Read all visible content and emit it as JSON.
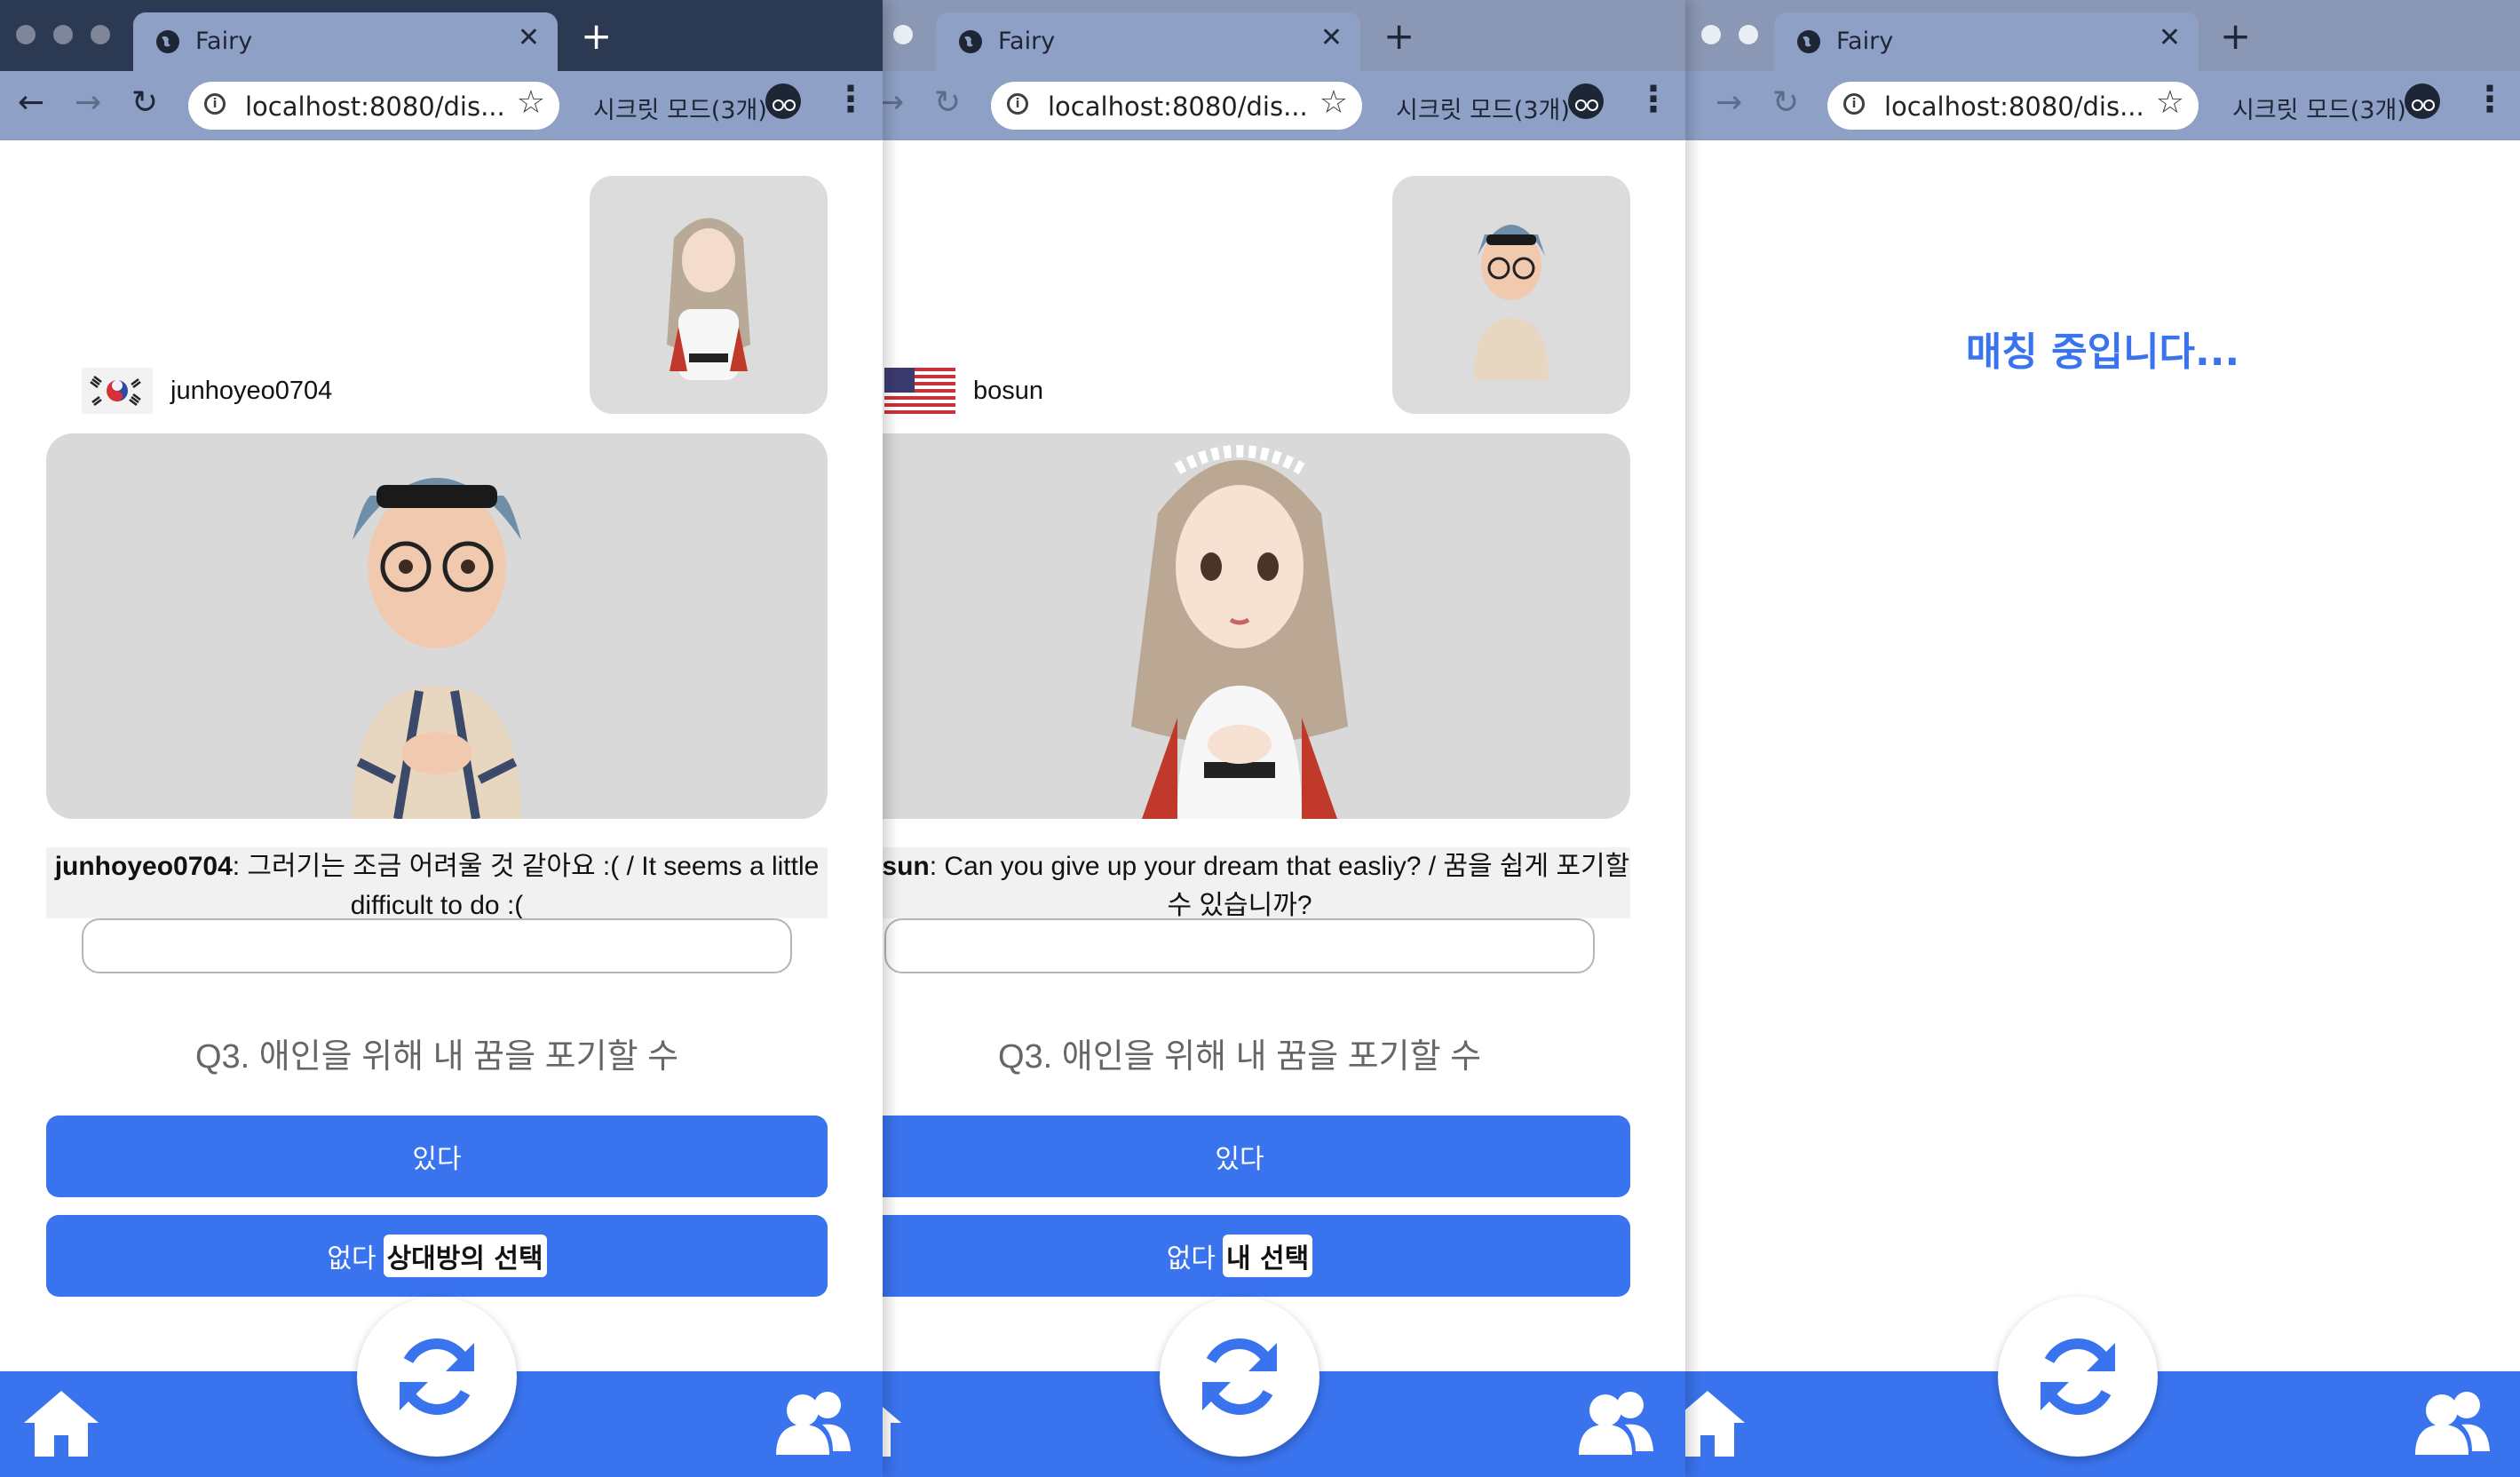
{
  "colors": {
    "accent": "#3a73ee",
    "video_bg": "#d9d9d9",
    "caption_bg": "#f1f1f1"
  },
  "browser": {
    "tab_title": "Fairy",
    "url": "localhost:8080/dis...",
    "incognito_label": "시크릿 모드(3개)"
  },
  "windows": [
    {
      "user": {
        "name": "junhoyeo0704",
        "flag": "south-korea-flag"
      },
      "caption": {
        "speaker": "junhoyeo0704",
        "text": ": 그러기는 조금 어려울 것 같아요 :( / It seems a little difficult to do :("
      },
      "question": "Q3. 애인을 위해 내 꿈을 포기할 수",
      "yes_label": "있다",
      "no_label": "없다",
      "selection_tag": "상대방의 선택"
    },
    {
      "user": {
        "name": "bosun",
        "flag": "usa-flag"
      },
      "caption": {
        "speaker": "bosun",
        "text": ": Can you give up your dream that easliy? / 꿈을 쉽게 포기할 수 있습니까?"
      },
      "question": "Q3. 애인을 위해 내 꿈을 포기할 수",
      "yes_label": "있다",
      "no_label": "없다",
      "selection_tag": "내 선택"
    },
    {
      "status": "매칭 중입니다..."
    }
  ]
}
